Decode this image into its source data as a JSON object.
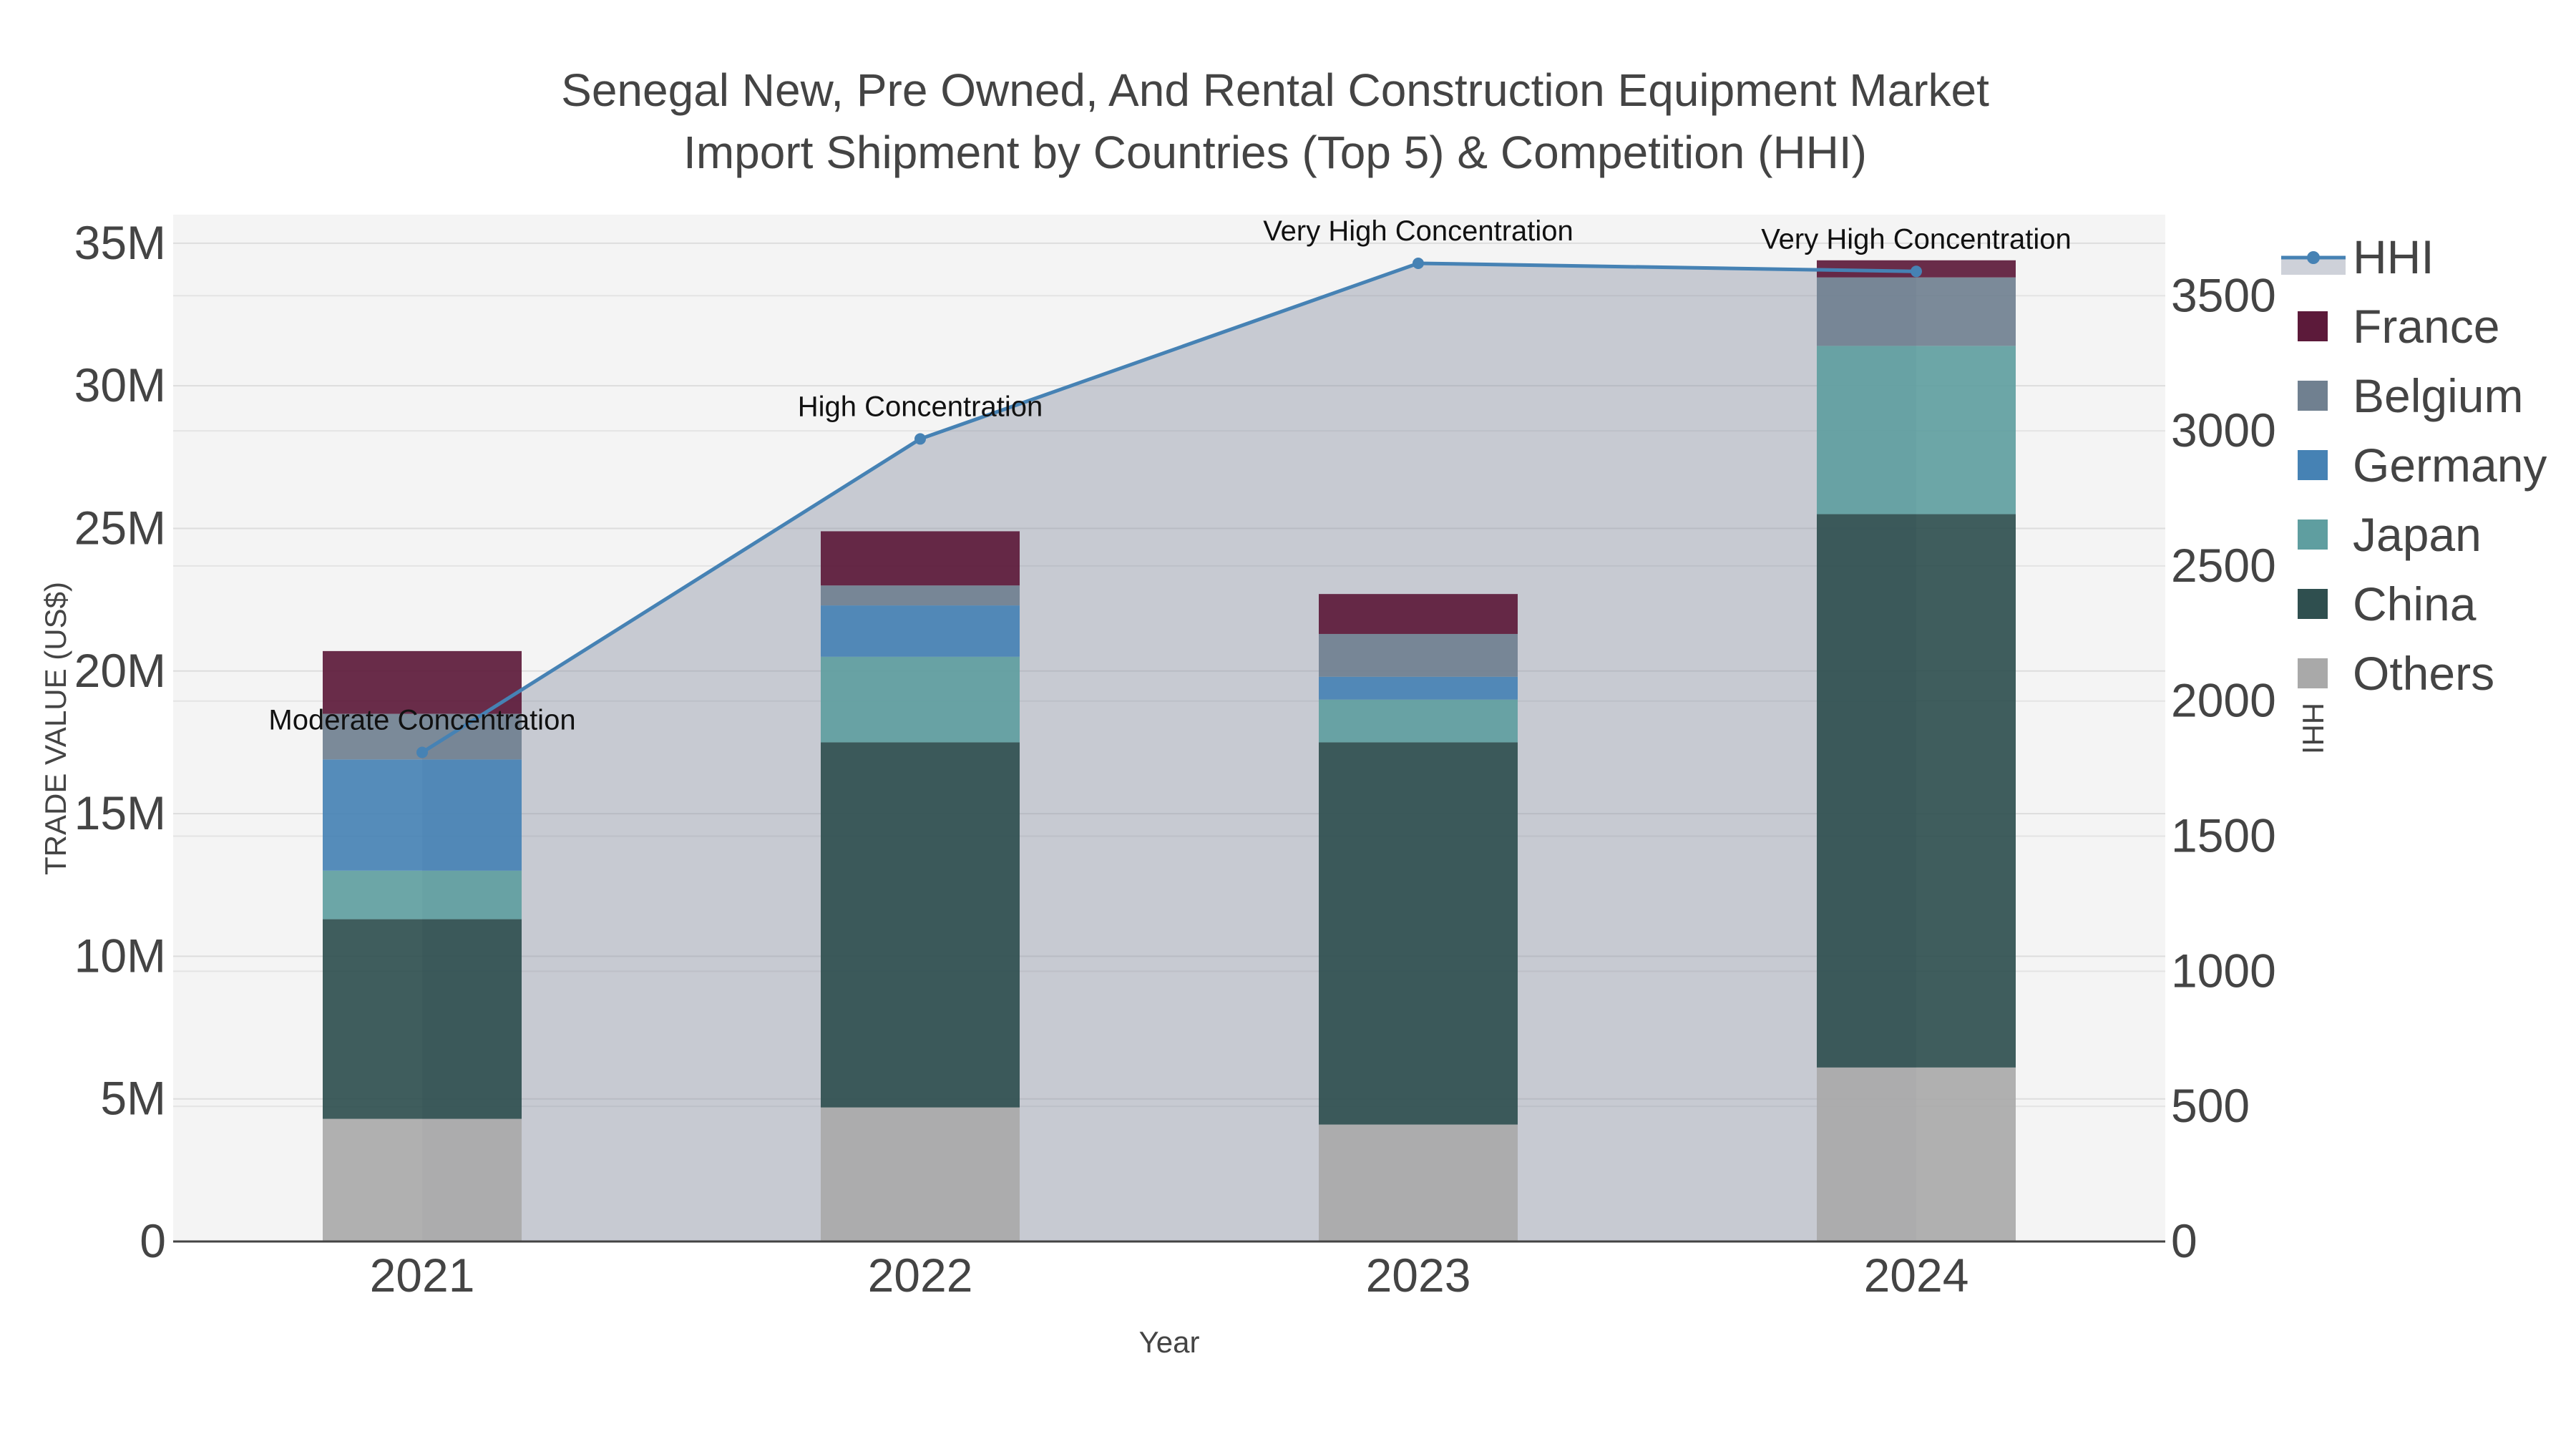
{
  "chart_data": {
    "type": "bar",
    "title_lines": [
      "Senegal New, Pre Owned, And Rental Construction Equipment Market",
      "Import Shipment by Countries (Top 5) & Competition (HHI)"
    ],
    "xlabel": "Year",
    "ylabel": "TRADE VALUE (US$)",
    "y2label": "HHI",
    "categories": [
      "2021",
      "2022",
      "2023",
      "2024"
    ],
    "ylim": [
      0,
      36000000
    ],
    "y_ticks": [
      0,
      5000000,
      10000000,
      15000000,
      20000000,
      25000000,
      30000000,
      35000000
    ],
    "y_tick_labels": [
      "0",
      "5M",
      "10M",
      "15M",
      "20M",
      "25M",
      "30M",
      "35M"
    ],
    "y2lim": [
      0,
      3800
    ],
    "y2_ticks": [
      0,
      500,
      1000,
      1500,
      2000,
      2500,
      3000,
      3500
    ],
    "y2_tick_labels": [
      "0",
      "500",
      "1000",
      "1500",
      "2000",
      "2500",
      "3000",
      "3500"
    ],
    "grid": true,
    "legend_position": "right",
    "series": [
      {
        "name": "Others",
        "color": "#a9a9a9",
        "values": [
          4300000,
          4700000,
          4100000,
          6100000
        ]
      },
      {
        "name": "China",
        "color": "#2f4f4f",
        "values": [
          7000000,
          12800000,
          13400000,
          19400000
        ]
      },
      {
        "name": "Japan",
        "color": "#5f9ea0",
        "values": [
          1700000,
          3000000,
          1500000,
          5900000
        ]
      },
      {
        "name": "Germany",
        "color": "#4682b4",
        "values": [
          3900000,
          1800000,
          800000,
          0
        ]
      },
      {
        "name": "Belgium",
        "color": "#708090",
        "values": [
          1600000,
          700000,
          1500000,
          2400000
        ]
      },
      {
        "name": "France",
        "color": "#5c1a3a",
        "values": [
          2200000,
          1900000,
          1400000,
          600000
        ]
      }
    ],
    "hhi": {
      "name": "HHI",
      "color": "#4682b4",
      "values": [
        1810,
        2970,
        3620,
        3590
      ],
      "annotations": [
        "Moderate Concentration",
        "High Concentration",
        "Very High Concentration",
        "Very High Concentration"
      ]
    },
    "legend_order": [
      "HHI",
      "France",
      "Belgium",
      "Germany",
      "Japan",
      "China",
      "Others"
    ]
  }
}
